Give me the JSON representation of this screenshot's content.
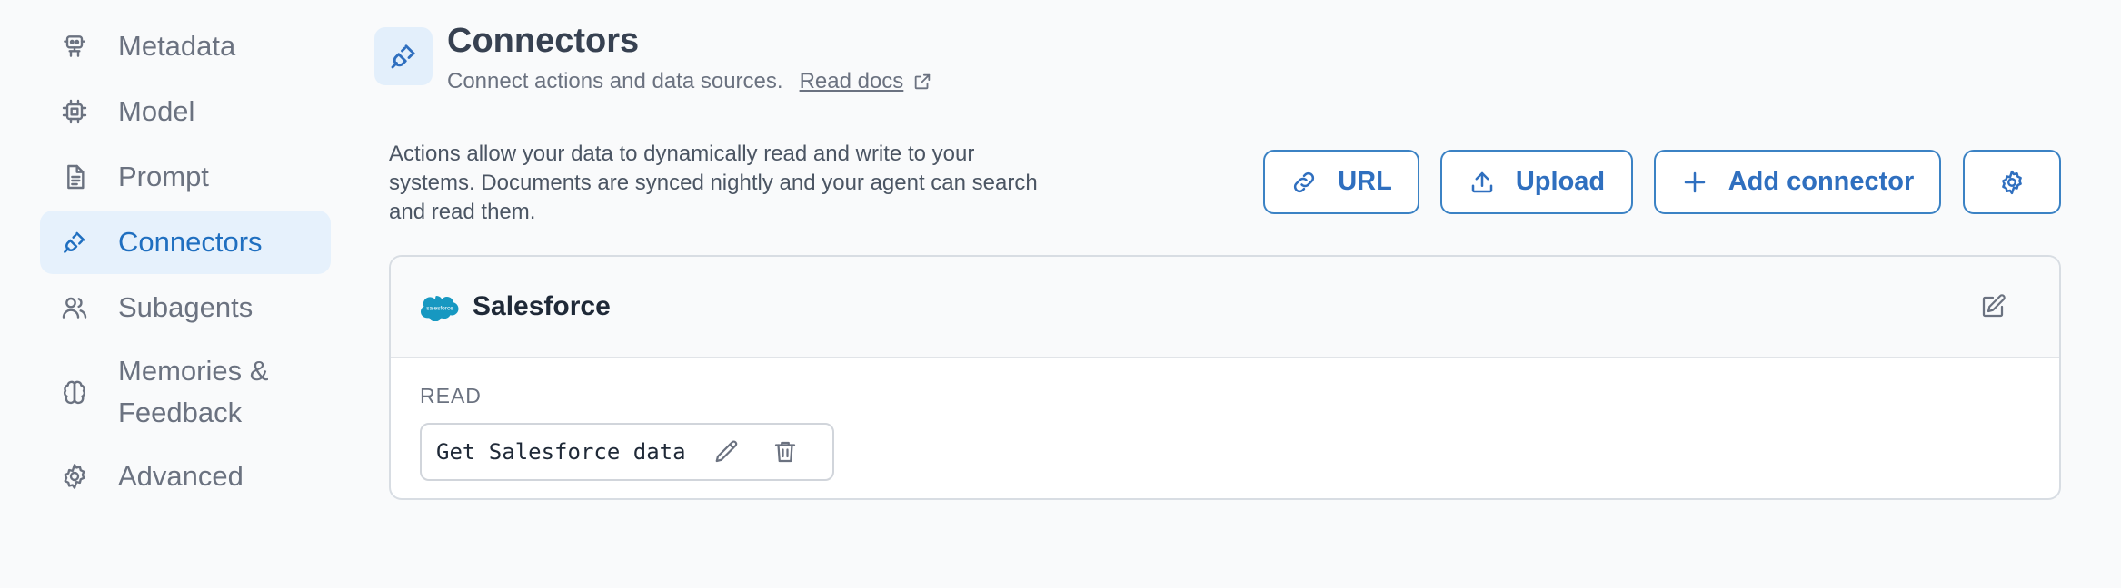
{
  "sidebar": {
    "items": [
      {
        "label": "Metadata",
        "icon": "robot-icon"
      },
      {
        "label": "Model",
        "icon": "chip-icon"
      },
      {
        "label": "Prompt",
        "icon": "document-icon"
      },
      {
        "label": "Connectors",
        "icon": "plug-icon",
        "active": true
      },
      {
        "label": "Subagents",
        "icon": "users-icon"
      },
      {
        "label": "Memories & Feedback",
        "icon": "brain-icon"
      },
      {
        "label": "Advanced",
        "icon": "gear-icon"
      }
    ]
  },
  "header": {
    "title": "Connectors",
    "subtitle": "Connect actions and data sources.",
    "docs_link": "Read docs"
  },
  "description": "Actions allow your data to dynamically read and write to your systems. Documents are synced nightly and your agent can search and read them.",
  "toolbar": {
    "url_label": "URL",
    "upload_label": "Upload",
    "add_label": "Add connector"
  },
  "connector": {
    "name": "Salesforce",
    "logo_text": "salesforce",
    "section_label": "READ",
    "actions": [
      {
        "name": "Get Salesforce data"
      }
    ]
  },
  "colors": {
    "accent": "#2f6fbf",
    "active_bg": "#e6f1fc",
    "salesforce_blue": "#1798c1"
  }
}
